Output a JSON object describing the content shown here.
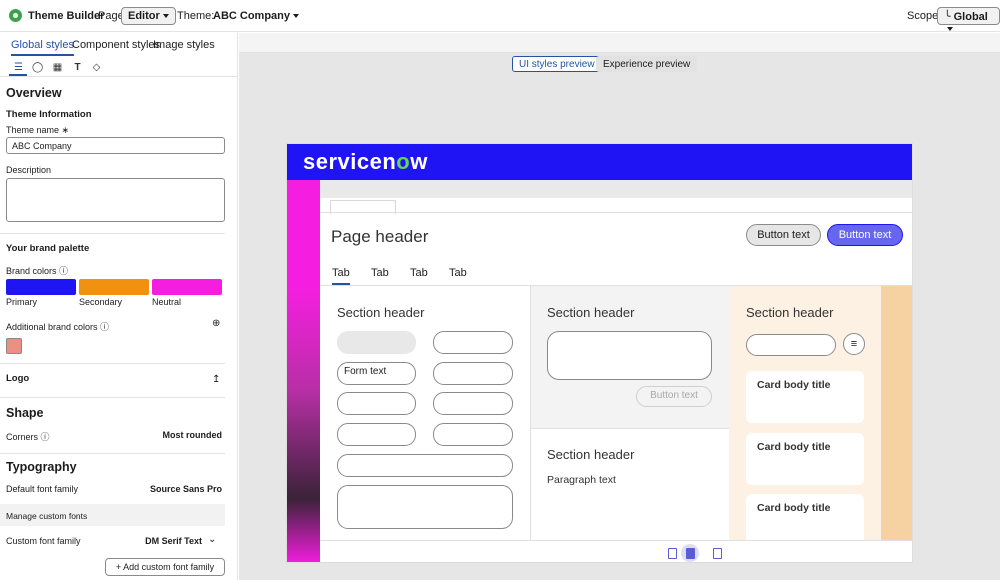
{
  "topbar": {
    "app_title": "Theme Builder",
    "page_label": "Page:",
    "page_value": "Editor",
    "theme_label": "Theme:",
    "theme_value": "ABC Company",
    "scope_label": "Scope:",
    "scope_value": "Global"
  },
  "left_tabs": [
    "Global styles",
    "Component styles",
    "Image styles"
  ],
  "left_icons": [
    "list-icon",
    "palette-icon",
    "image-icon",
    "text-icon",
    "tag-icon"
  ],
  "overview": {
    "title": "Overview",
    "theme_info": "Theme Information",
    "theme_name_label": "Theme name ∗",
    "theme_name_value": "ABC Company",
    "description_label": "Description",
    "description_value": ""
  },
  "brand": {
    "title": "Your brand palette",
    "brand_colors_label": "Brand colors ⓘ",
    "colors": [
      {
        "label": "Primary",
        "color": "#1f14f3"
      },
      {
        "label": "Secondary",
        "color": "#f2900f"
      },
      {
        "label": "Neutral",
        "color": "#f51ee0"
      }
    ],
    "additional_label": "Additional brand colors ⓘ",
    "additional_color": "#ee8f84"
  },
  "logo": {
    "label": "Logo"
  },
  "shape": {
    "title": "Shape",
    "corners_label": "Corners ⓘ",
    "corners_value": "Most rounded"
  },
  "typography": {
    "title": "Typography",
    "default_label": "Default font family",
    "default_value": "Source Sans Pro",
    "manage_label": "Manage custom fonts",
    "custom_label": "Custom font family",
    "custom_value": "DM Serif Text",
    "add_button": "+ Add custom font family"
  },
  "preview_toggle": {
    "ui": "UI styles preview",
    "experience": "Experience preview"
  },
  "preview": {
    "brand_logo_a": "servicen",
    "brand_logo_b": "o",
    "brand_logo_c": "w",
    "page_header": "Page header",
    "button_secondary": "Button text",
    "button_primary": "Button text",
    "tabs": [
      "Tab",
      "Tab",
      "Tab",
      "Tab"
    ],
    "section1": "Section header",
    "form_text": "Form text",
    "section2": "Section header",
    "disabled_button": "Button text",
    "section3": "Section header",
    "paragraph": "Paragraph text",
    "section4": "Section header",
    "cards": [
      "Card body title",
      "Card body title",
      "Card body title"
    ]
  }
}
